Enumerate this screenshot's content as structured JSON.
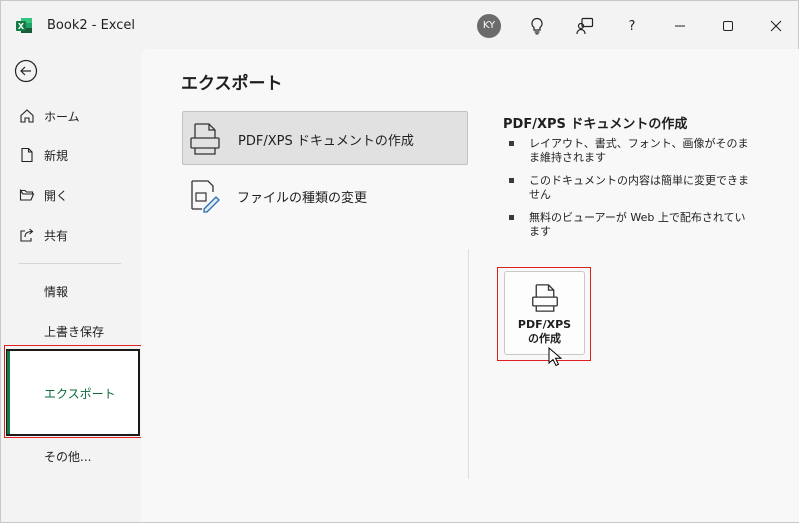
{
  "window": {
    "title": "Book2  -  Excel",
    "avatar_initials": "KY"
  },
  "nav": {
    "items": [
      {
        "label": "ホーム",
        "icon": "home-icon"
      },
      {
        "label": "新規",
        "icon": "new-document-icon"
      },
      {
        "label": "開く",
        "icon": "folder-open-icon"
      },
      {
        "label": "共有",
        "icon": "share-icon"
      }
    ],
    "text_items": [
      "情報",
      "上書き保存",
      "エクスポート",
      "その他..."
    ],
    "active": "エクスポート"
  },
  "main": {
    "title": "エクスポート",
    "options": [
      {
        "label": "PDF/XPS ドキュメントの作成",
        "selected": true
      },
      {
        "label": "ファイルの種類の変更",
        "selected": false
      }
    ],
    "detail": {
      "title": "PDF/XPS ドキュメントの作成",
      "bullets": [
        "レイアウト、書式、フォント、画像がそのまま維持されます",
        "このドキュメントの内容は簡単に変更できません",
        "無料のビューアーが Web 上で配布されています"
      ],
      "button_line1": "PDF/XPS",
      "button_line2": "の作成"
    }
  },
  "colors": {
    "accent": "#107c41",
    "highlight_outline": "#e02020"
  }
}
